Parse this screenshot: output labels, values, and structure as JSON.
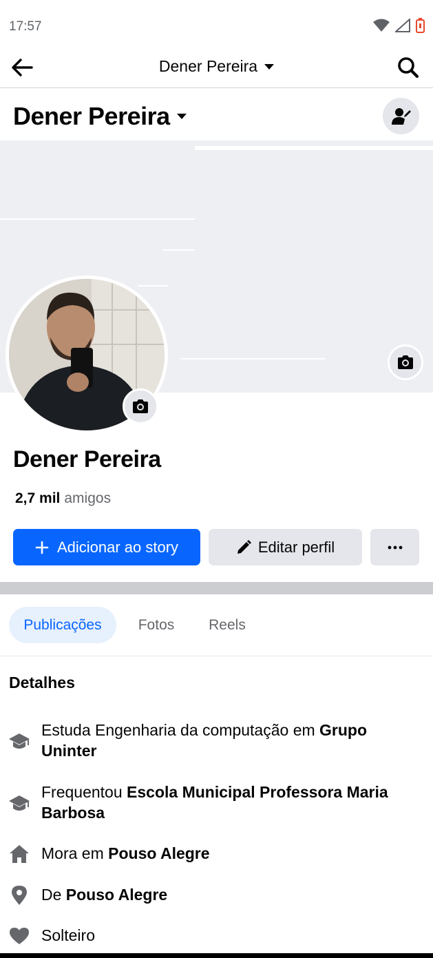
{
  "status_bar": {
    "time": "17:57",
    "icons": [
      "wifi-icon",
      "signal-icon",
      "battery-icon"
    ],
    "battery_color": "#e8482c"
  },
  "header": {
    "title": "Dener Pereira",
    "back_icon": "arrow-left-icon",
    "search_icon": "search-icon",
    "dropdown_icon": "caret-down-icon"
  },
  "profile_bar": {
    "name": "Dener Pereira",
    "action_icon": "user-edit-icon"
  },
  "profile": {
    "name": "Dener Pereira",
    "friends_count": "2,7 mil",
    "friends_label": "amigos",
    "avatar_camera_icon": "camera-icon",
    "cover_camera_icon": "camera-icon"
  },
  "actions": {
    "story_label": "Adicionar ao story",
    "edit_label": "Editar perfil",
    "more_icon": "more-horizontal-icon",
    "primary_color": "#0866ff",
    "secondary_color": "#e4e6eb"
  },
  "tabs": [
    {
      "label": "Publicações",
      "active": true
    },
    {
      "label": "Fotos",
      "active": false
    },
    {
      "label": "Reels",
      "active": false
    }
  ],
  "details": {
    "title": "Detalhes",
    "items": [
      {
        "icon": "graduation-cap-icon",
        "text": "Estuda Engenharia da computação em ",
        "bold": "Grupo Uninter"
      },
      {
        "icon": "graduation-cap-icon",
        "text": "Frequentou ",
        "bold": "Escola Municipal Professora Maria Barbosa"
      },
      {
        "icon": "home-icon",
        "text": "Mora em ",
        "bold": "Pouso Alegre"
      },
      {
        "icon": "location-pin-icon",
        "text": "De ",
        "bold": "Pouso Alegre"
      },
      {
        "icon": "heart-icon",
        "text": "Solteiro",
        "bold": ""
      }
    ]
  }
}
